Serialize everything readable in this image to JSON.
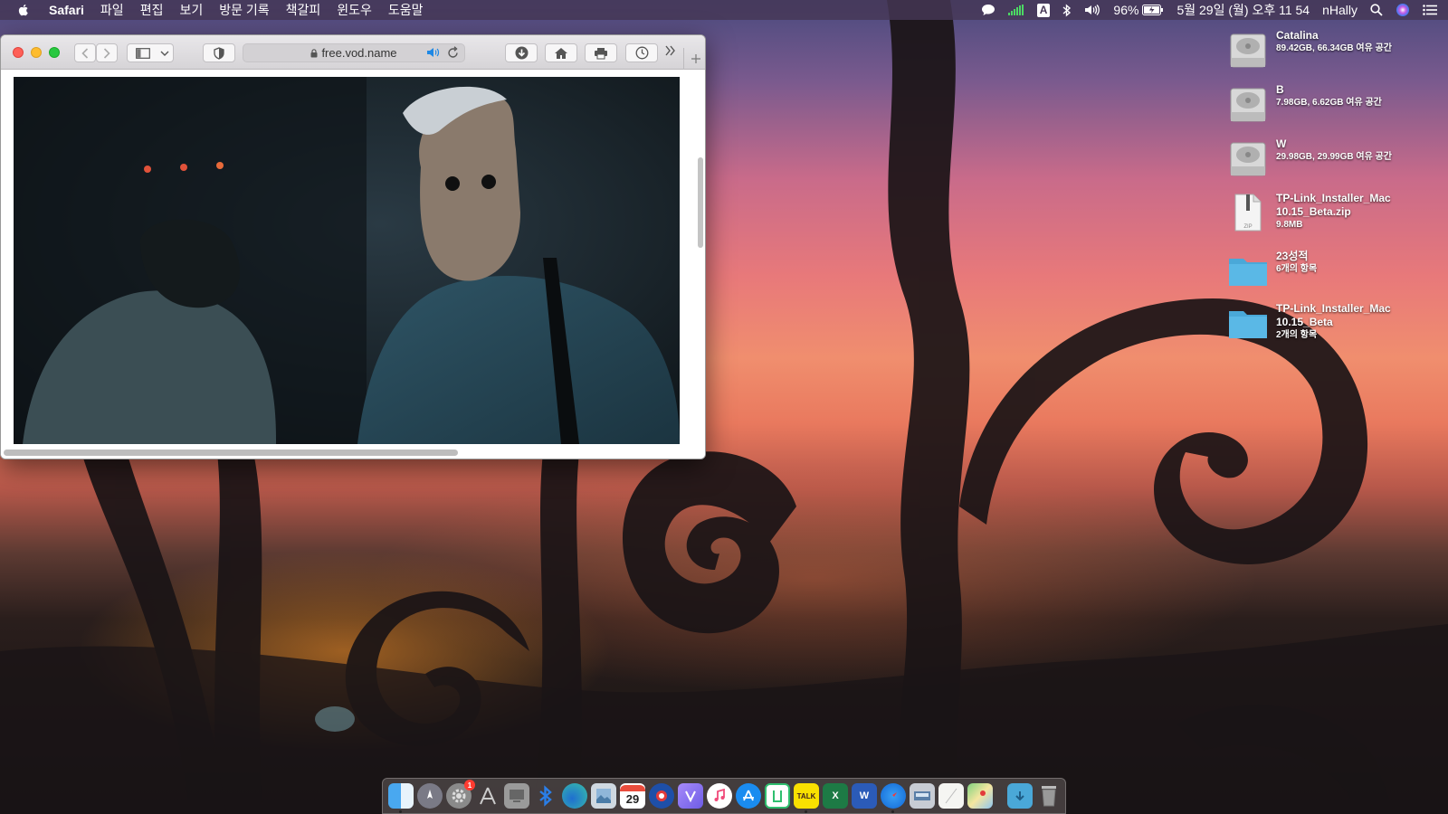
{
  "menubar": {
    "app_name": "Safari",
    "menus": [
      "파일",
      "편집",
      "보기",
      "방문 기록",
      "책갈피",
      "윈도우",
      "도움말"
    ],
    "input_source": "A",
    "battery": "96%",
    "datetime": "5월 29일 (월) 오후 11 54",
    "user": "nHally"
  },
  "browser": {
    "url": "free.vod.name",
    "buttons": [
      "back",
      "forward",
      "sidebar",
      "shield",
      "download",
      "home",
      "print",
      "history"
    ]
  },
  "desktop": {
    "items": [
      {
        "name": "Catalina",
        "detail": "89.42GB, 66.34GB 여유 공간",
        "icon": "hard-drive-icon"
      },
      {
        "name": "B",
        "detail": "7.98GB, 6.62GB 여유 공간",
        "icon": "hard-drive-icon"
      },
      {
        "name": "W",
        "detail": "29.98GB, 29.99GB 여유 공간",
        "icon": "hard-drive-icon"
      },
      {
        "name": "TP-Link_Installer_Mac 10.15_Beta.zip",
        "detail": "9.8MB",
        "icon": "zip-file-icon"
      },
      {
        "name": "23성적",
        "detail": "6개의 항목",
        "icon": "folder-icon"
      },
      {
        "name": "TP-Link_Installer_Mac 10.15_Beta",
        "detail": "2개의 항목",
        "icon": "folder-icon"
      }
    ]
  },
  "dock": {
    "apps": [
      "Finder",
      "Launchpad",
      "System Preferences",
      "Automator",
      "Migration",
      "Bluetooth",
      "Edge",
      "Preview",
      "Calendar",
      "Photo Booth",
      "Notes",
      "Music",
      "App Store",
      "Line",
      "KakaoTalk",
      "Excel",
      "Word",
      "Safari",
      "Image Capture",
      "TextEdit",
      "Maps"
    ],
    "calendar_day": "29",
    "system_prefs_badge": "1",
    "talk_label": "TALK",
    "word_label": "W",
    "excel_label": "X"
  },
  "colors": {
    "accent": "#0a84ff",
    "folder": "#5ab8e6"
  }
}
